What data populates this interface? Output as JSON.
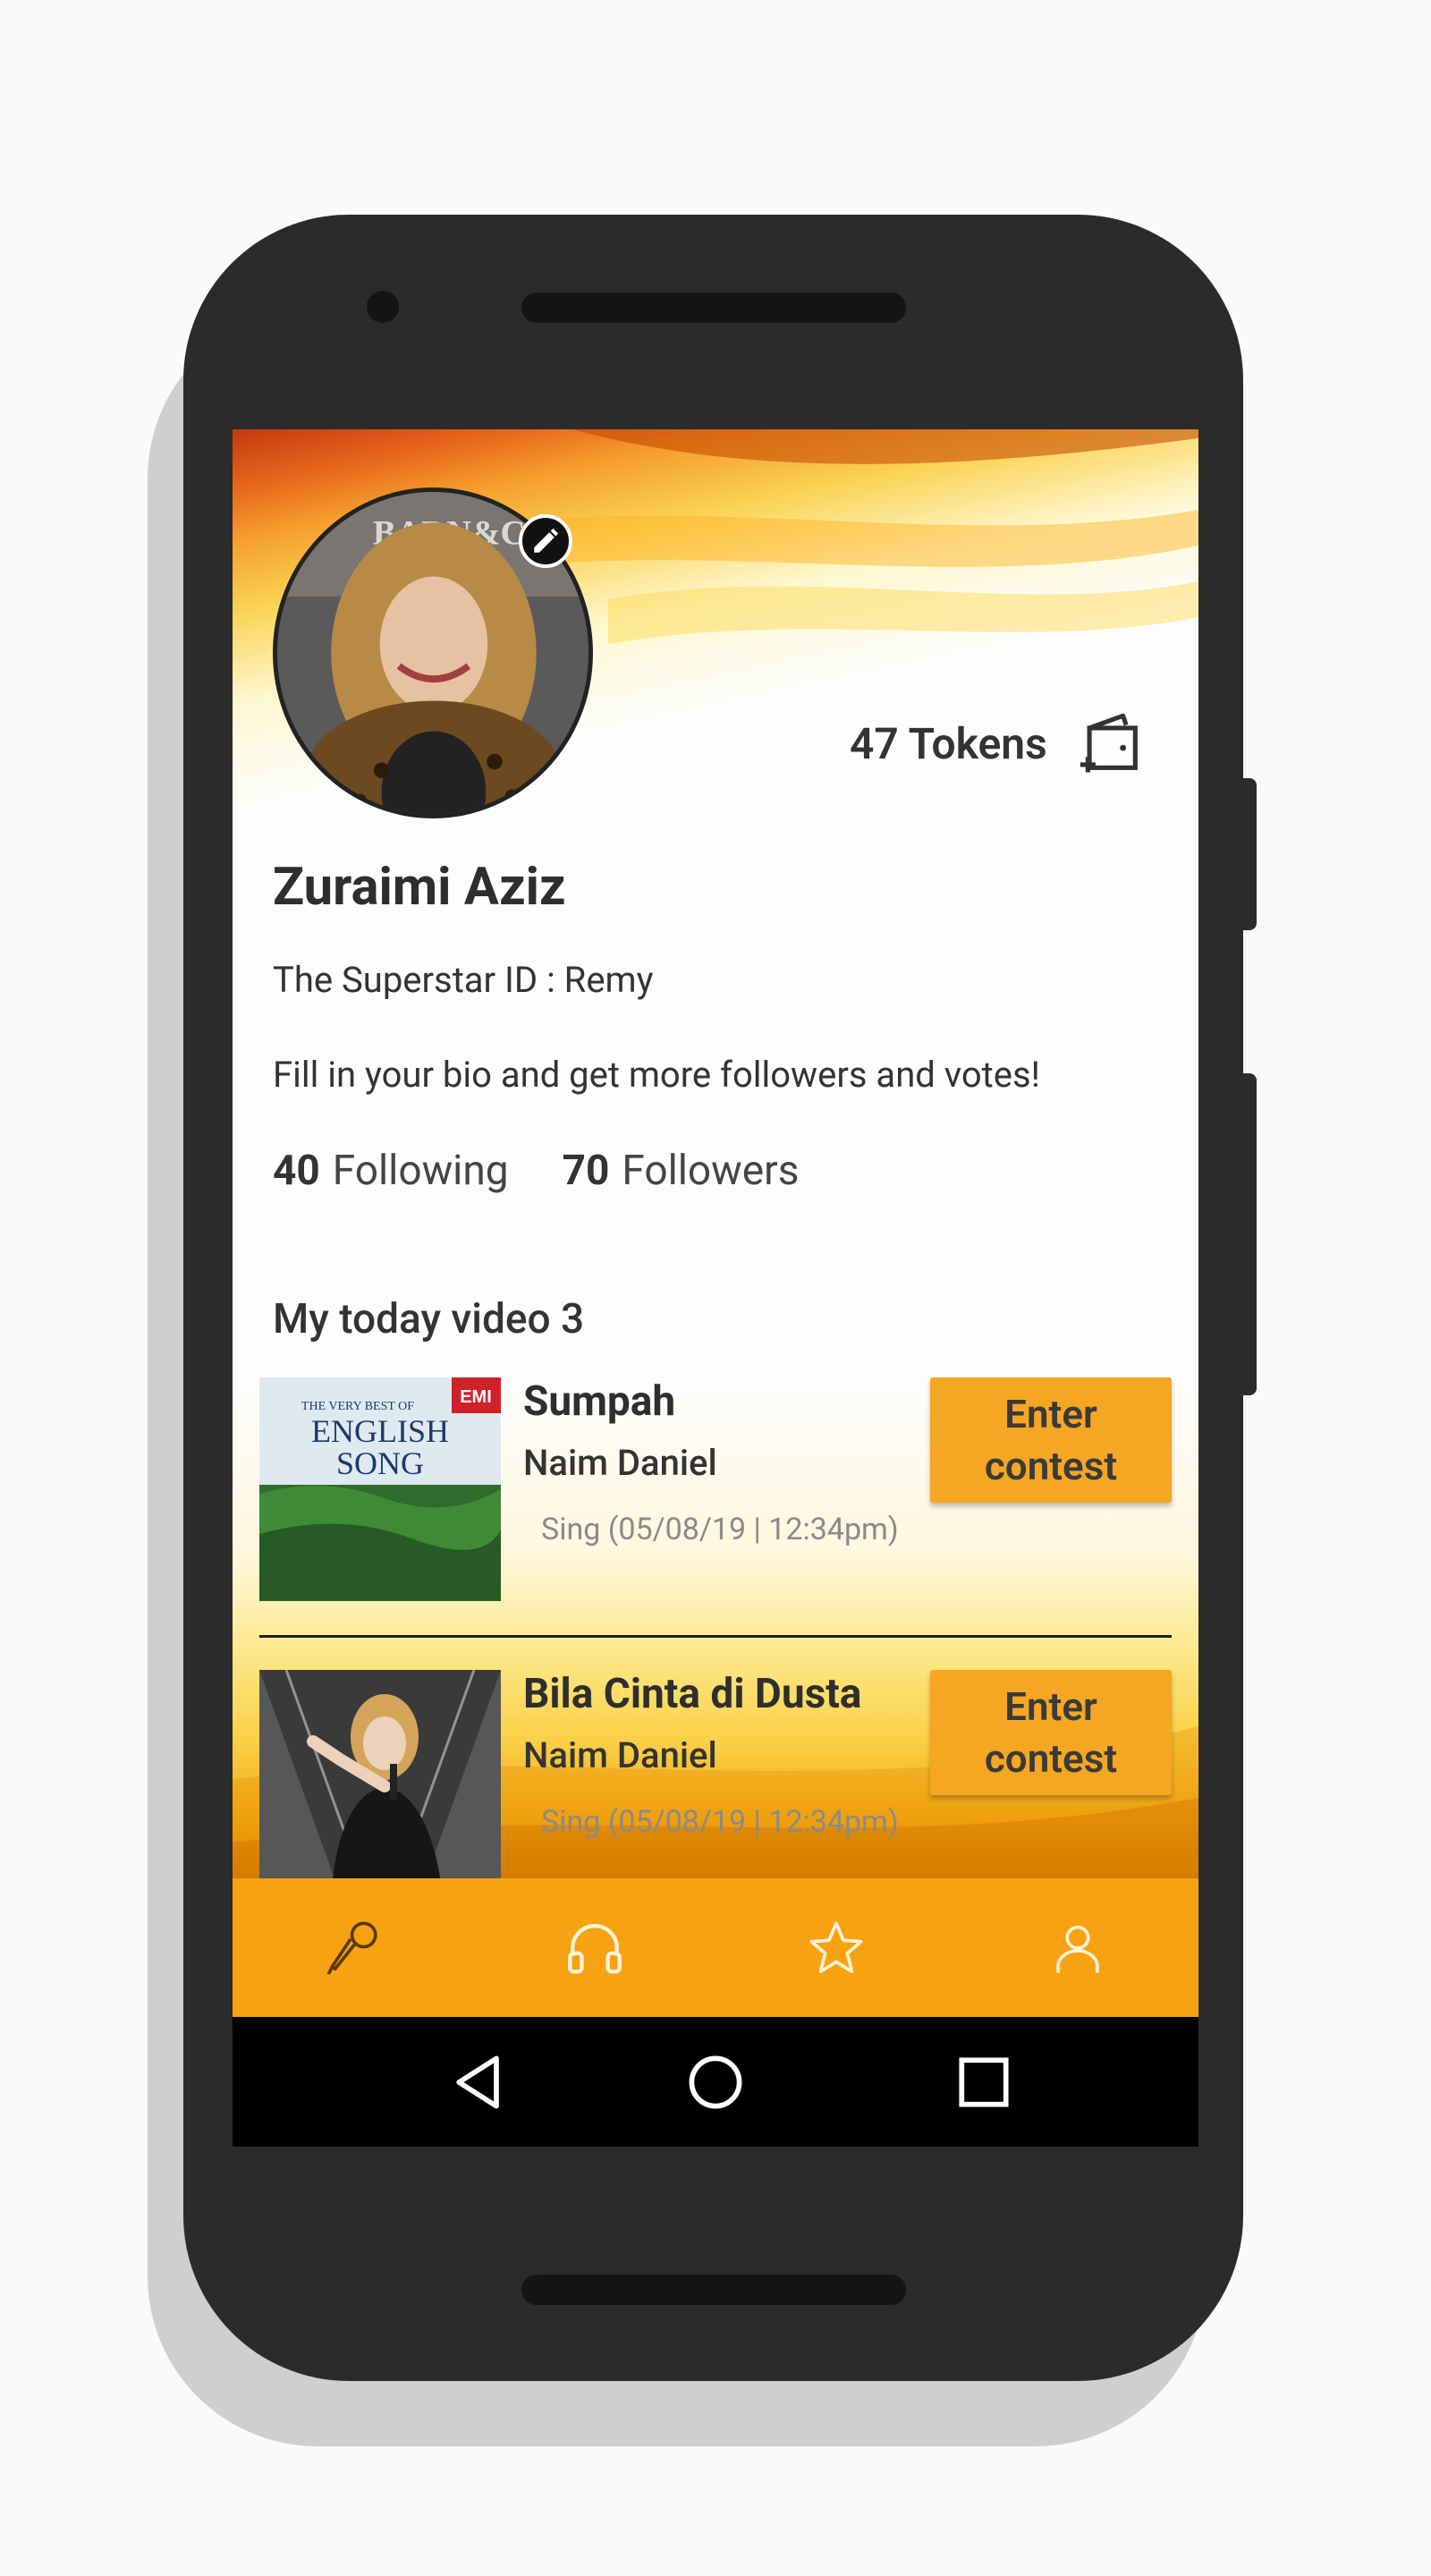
{
  "profile": {
    "name": "Zuraimi Aziz",
    "superstar_id": "The Superstar ID : Remy",
    "bio_prompt": "Fill in your bio and get more followers and votes!",
    "following_count": "40",
    "following_label": "Following",
    "followers_count": "70",
    "followers_label": "Followers"
  },
  "wallet": {
    "tokens_label": "47 Tokens",
    "icon": "wallet-add-icon"
  },
  "videos": {
    "section_title": "My today video 3",
    "items": [
      {
        "title": "Sumpah",
        "artist": "Naim Daniel",
        "meta": "Sing (05/08/19 | 12:34pm)",
        "button_label": "Enter contest",
        "thumbnail_text": [
          "THE VERY BEST OF",
          "ENGLISH",
          "SONG",
          "EMI"
        ]
      },
      {
        "title": "Bila Cinta di Dusta",
        "artist": "Naim Daniel",
        "meta": "Sing (05/08/19 | 12:34pm)",
        "button_label": "Enter contest"
      }
    ]
  },
  "bottom_nav": {
    "items": [
      {
        "icon": "microphone-icon"
      },
      {
        "icon": "headphones-icon"
      },
      {
        "icon": "star-icon"
      },
      {
        "icon": "profile-icon"
      }
    ]
  },
  "colors": {
    "accent": "#f7a213",
    "button": "#f5a623",
    "text": "#333333"
  }
}
